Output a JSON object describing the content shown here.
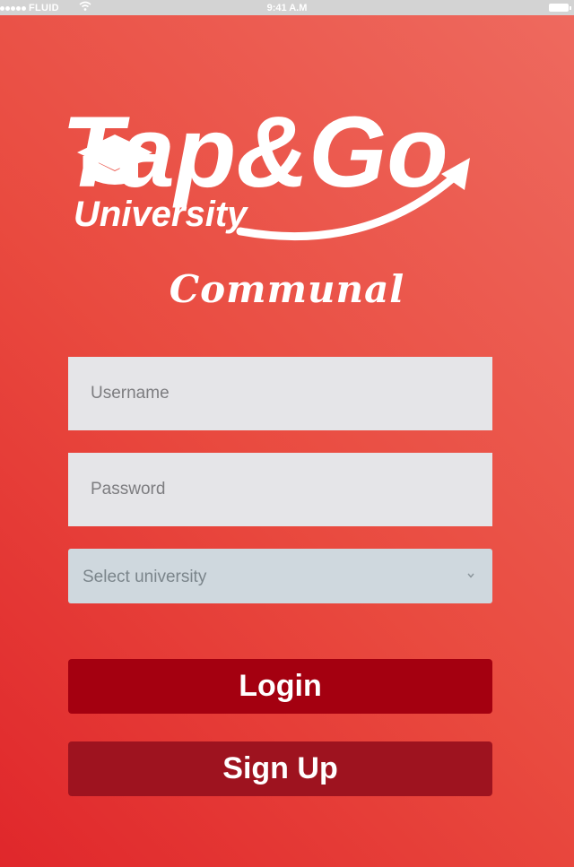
{
  "status_bar": {
    "carrier": "FLUID",
    "time": "9:41 A.M"
  },
  "logo": {
    "brand_main": "Tap&Go",
    "brand_sub": "University",
    "icon": "graduation-cap-icon"
  },
  "subtitle": "Communal",
  "form": {
    "username_placeholder": "Username",
    "password_placeholder": "Password",
    "university_select": "Select university"
  },
  "buttons": {
    "login": "Login",
    "signup": "Sign Up"
  },
  "colors": {
    "background_start": "#e0272b",
    "background_end": "#ee6a5f",
    "login_button": "#a40010",
    "signup_button": "#9e131f",
    "field": "#e5e5e8",
    "select": "#cfd8de"
  }
}
